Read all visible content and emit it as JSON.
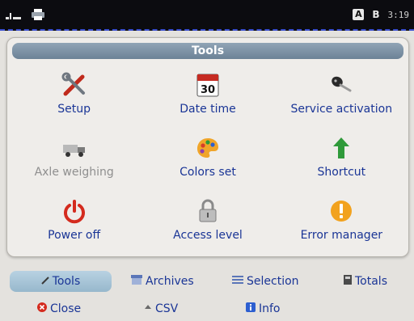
{
  "status_bar": {
    "badge_a": "A",
    "badge_b": "B",
    "time": "3:19"
  },
  "panel": {
    "title": "Tools",
    "items": [
      {
        "label": "Setup",
        "icon": "tools-icon",
        "enabled": true
      },
      {
        "label": "Date time",
        "icon": "calendar-icon",
        "enabled": true
      },
      {
        "label": "Service activation",
        "icon": "key-icon",
        "enabled": true
      },
      {
        "label": "Axle weighing",
        "icon": "truck-icon",
        "enabled": false
      },
      {
        "label": "Colors set",
        "icon": "palette-icon",
        "enabled": true
      },
      {
        "label": "Shortcut",
        "icon": "arrow-up-icon",
        "enabled": true
      },
      {
        "label": "Power off",
        "icon": "power-icon",
        "enabled": true
      },
      {
        "label": "Access level",
        "icon": "padlock-icon",
        "enabled": true
      },
      {
        "label": "Error manager",
        "icon": "warning-icon",
        "enabled": true
      }
    ],
    "calendar_day": "30"
  },
  "tabs": {
    "tools": "Tools",
    "archives": "Archives",
    "selection": "Selection",
    "totals": "Totals",
    "close": "Close",
    "csv": "CSV",
    "info": "Info",
    "active": "Tools"
  },
  "colors": {
    "label": "#1a3596",
    "header": "#7f96aa",
    "statusbar": "#0c0c10"
  }
}
